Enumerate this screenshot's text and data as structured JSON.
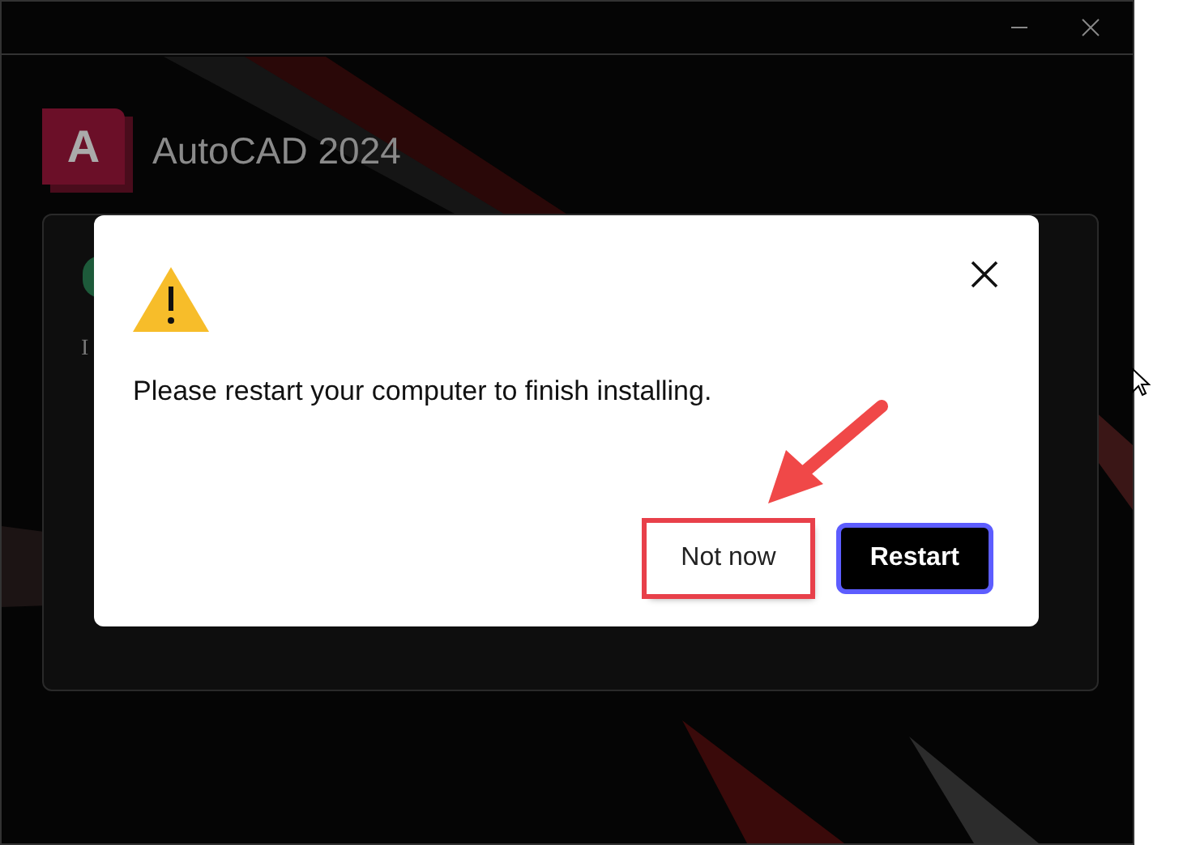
{
  "window": {
    "app_name": "AutoCAD 2024",
    "logo_letter": "A"
  },
  "background_card": {
    "text": "I"
  },
  "dialog": {
    "message": "Please restart your computer to finish installing.",
    "buttons": [
      {
        "label": "Not now",
        "kind": "secondary",
        "highlighted": true
      },
      {
        "label": "Restart",
        "kind": "primary",
        "highlighted": false
      }
    ]
  }
}
